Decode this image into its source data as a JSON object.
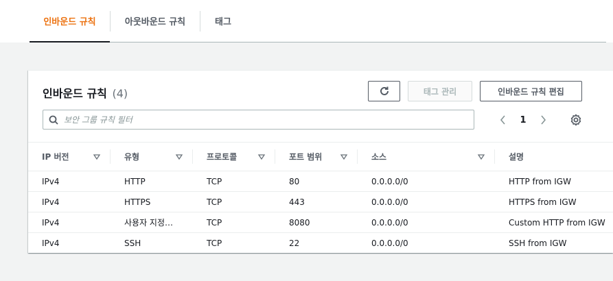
{
  "tabs": [
    {
      "label": "인바운드 규칙",
      "active": true
    },
    {
      "label": "아웃바운드 규칙",
      "active": false
    },
    {
      "label": "태그",
      "active": false
    }
  ],
  "card": {
    "title": "인바운드 규칙",
    "count": "(4)",
    "buttons": {
      "refresh_icon": "refresh-icon",
      "manage_tags": "태그 관리",
      "edit_rules": "인바운드 규칙 편집"
    },
    "filter": {
      "placeholder": "보안 그룹 규칙 필터",
      "value": ""
    },
    "pagination": {
      "current_page": "1"
    }
  },
  "table": {
    "columns": [
      "IP 버전",
      "유형",
      "프로토콜",
      "포트 범위",
      "소스",
      "설명"
    ],
    "rows": [
      [
        "IPv4",
        "HTTP",
        "TCP",
        "80",
        "0.0.0.0/0",
        "HTTP from IGW"
      ],
      [
        "IPv4",
        "HTTPS",
        "TCP",
        "443",
        "0.0.0.0/0",
        "HTTPS from IGW"
      ],
      [
        "IPv4",
        "사용자 지정…",
        "TCP",
        "8080",
        "0.0.0.0/0",
        "Custom HTTP from IGW"
      ],
      [
        "IPv4",
        "SSH",
        "TCP",
        "22",
        "0.0.0.0/0",
        "SSH from IGW"
      ]
    ]
  },
  "colors": {
    "accent": "#ec7211",
    "text": "#16191f",
    "muted": "#545b64",
    "disabled": "#aab7b8",
    "background": "#f2f3f3"
  }
}
